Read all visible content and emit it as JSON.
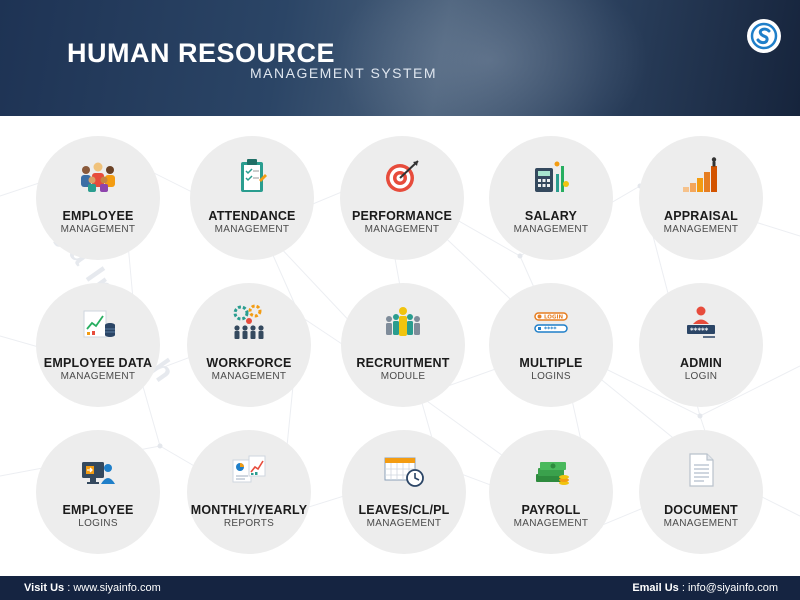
{
  "header": {
    "title": "HUMAN RESOURCE",
    "subtitle": "MANAGEMENT SYSTEM"
  },
  "watermark": "Siya Infotech",
  "modules": [
    {
      "line1": "EMPLOYEE",
      "line2": "MANAGEMENT",
      "icon": "team-icon"
    },
    {
      "line1": "ATTENDANCE",
      "line2": "MANAGEMENT",
      "icon": "clipboard-icon"
    },
    {
      "line1": "PERFORMANCE",
      "line2": "MANAGEMENT",
      "icon": "target-icon"
    },
    {
      "line1": "SALARY",
      "line2": "MANAGEMENT",
      "icon": "calculator-icon"
    },
    {
      "line1": "APPRAISAL",
      "line2": "MANAGEMENT",
      "icon": "growth-stairs-icon"
    },
    {
      "line1": "EMPLOYEE DATA",
      "line2": "MANAGEMENT",
      "icon": "data-chart-icon"
    },
    {
      "line1": "WORKFORCE",
      "line2": "MANAGEMENT",
      "icon": "workforce-gears-icon"
    },
    {
      "line1": "RECRUITMENT",
      "line2": "MODULE",
      "icon": "candidate-icon"
    },
    {
      "line1": "MULTIPLE",
      "line2": "LOGINS",
      "icon": "login-fields-icon"
    },
    {
      "line1": "ADMIN",
      "line2": "LOGIN",
      "icon": "admin-icon"
    },
    {
      "line1": "EMPLOYEE",
      "line2": "LOGINS",
      "icon": "employee-login-icon"
    },
    {
      "line1": "MONTHLY/YEARLY",
      "line2": "REPORTS",
      "icon": "reports-icon"
    },
    {
      "line1": "LEAVES/CL/PL",
      "line2": "MANAGEMENT",
      "icon": "calendar-clock-icon"
    },
    {
      "line1": "PAYROLL",
      "line2": "MANAGEMENT",
      "icon": "money-stack-icon"
    },
    {
      "line1": "DOCUMENT",
      "line2": "MANAGEMENT",
      "icon": "document-icon"
    }
  ],
  "footer": {
    "visit_label": "Visit Us",
    "visit_value": " : www.siyainfo.com",
    "email_label": "Email Us",
    "email_value": " : info@siyainfo.com"
  },
  "colors": {
    "header_bg": "#1e3354",
    "footer_bg": "#152441",
    "circle_bg": "#ededed",
    "accent_orange": "#f39c12",
    "accent_red": "#e74c3c",
    "accent_teal": "#2a9d8f"
  }
}
